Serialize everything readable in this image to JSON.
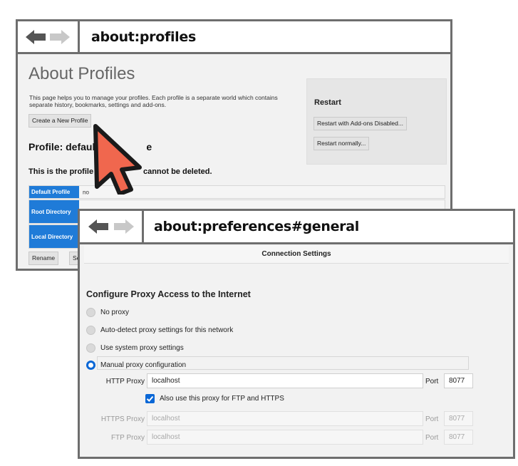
{
  "window1": {
    "url": "about:profiles",
    "page_title": "About Profiles",
    "description": "This page helps you to manage your profiles. Each profile is a separate world which contains separate history, bookmarks, settings and add-ons.",
    "create_button": "Create a New Profile",
    "profile_heading_left": "Profile: defaul",
    "profile_heading_right": "e",
    "note_left": "This is the profile in ",
    "note_right": "cannot be deleted.",
    "rows": [
      {
        "label": "Default Profile",
        "value": "no"
      },
      {
        "label": "Root Directory",
        "value": ""
      },
      {
        "label": "Local Directory",
        "value": ""
      }
    ],
    "rename_button": "Rename",
    "set_default_partial": "Se",
    "restart": {
      "title": "Restart",
      "addons_disabled": "Restart with Add-ons Disabled...",
      "normally": "Restart normally..."
    }
  },
  "window2": {
    "url": "about:preferences#general",
    "dialog_title": "Connection Settings",
    "heading": "Configure Proxy Access to the Internet",
    "options": [
      {
        "label": "No proxy",
        "selected": false
      },
      {
        "label": "Auto-detect proxy settings for this network",
        "selected": false
      },
      {
        "label": "Use system proxy settings",
        "selected": false
      },
      {
        "label": "Manual proxy configuration",
        "selected": true
      }
    ],
    "http_proxy": {
      "label": "HTTP Proxy",
      "value": "localhost",
      "port_label": "Port",
      "port": "8077"
    },
    "also_use_label": "Also use this proxy for FTP and HTTPS",
    "also_use_checked": true,
    "https_proxy": {
      "label": "HTTPS Proxy",
      "value": "localhost",
      "port_label": "Port",
      "port": "8077"
    },
    "ftp_proxy": {
      "label": "FTP Proxy",
      "value": "localhost",
      "port_label": "Port",
      "port": "8077"
    }
  },
  "colors": {
    "accent": "#0a67d6",
    "profile_header": "#1f7bd8",
    "cursor": "#f0674e",
    "frame": "#6e6e6e"
  }
}
